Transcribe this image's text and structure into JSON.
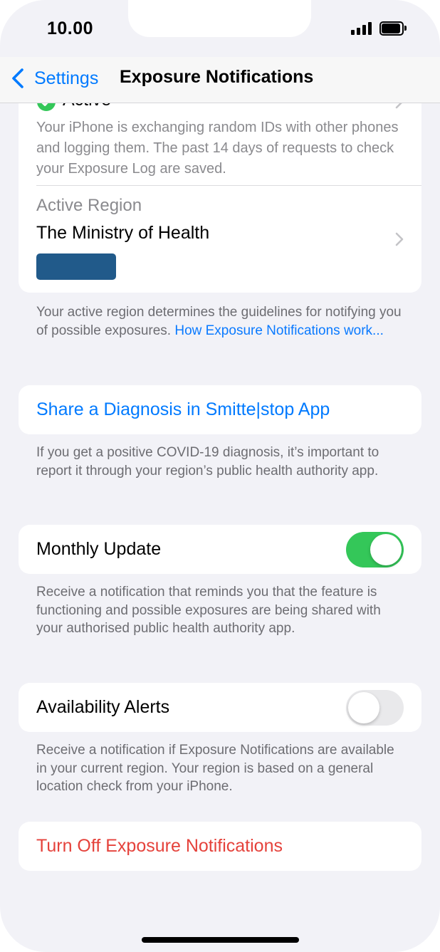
{
  "status_bar": {
    "time": "10.00"
  },
  "nav": {
    "back_label": "Settings",
    "title": "Exposure Notifications"
  },
  "status_card": {
    "status_label": "Active",
    "description": "Your iPhone is exchanging random IDs with other phones and logging them. The past 14 days of requests to check your Exposure Log are saved.",
    "region_heading": "Active Region",
    "region_name": "The Ministry of Health"
  },
  "region_footer": {
    "text": "Your active region determines the guidelines for notifying you of possible exposures. ",
    "link": "How Exposure Notifications work..."
  },
  "share": {
    "label": "Share a Diagnosis in Smitte|stop App",
    "footer": "If you get a positive COVID-19 diagnosis, it’s important to report it through your region’s public health authority app."
  },
  "monthly_update": {
    "label": "Monthly Update",
    "enabled": true,
    "footer": "Receive a notification that reminds you that the feature is functioning and possible exposures are being shared with your authorised public health authority app."
  },
  "availability_alerts": {
    "label": "Availability Alerts",
    "enabled": false,
    "footer": "Receive a notification if Exposure Notifications are available in your current region. Your region is based on a general location check from your iPhone."
  },
  "turn_off": {
    "label": "Turn Off Exposure Notifications"
  },
  "colors": {
    "accent": "#007aff",
    "toggle_on": "#34c759",
    "destructive": "#e5423b",
    "region_logo": "#215a8a"
  }
}
